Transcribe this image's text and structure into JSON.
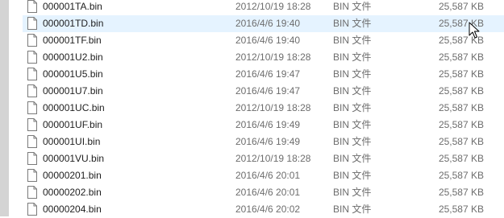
{
  "files": [
    {
      "name": "000001TA.bin",
      "date": "2012/10/19 18:28",
      "type": "BIN 文件",
      "size": "25,587 KB"
    },
    {
      "name": "000001TD.bin",
      "date": "2016/4/6 19:40",
      "type": "BIN 文件",
      "size": "25,587 KB"
    },
    {
      "name": "000001TF.bin",
      "date": "2016/4/6 19:40",
      "type": "BIN 文件",
      "size": "25,587 KB"
    },
    {
      "name": "000001U2.bin",
      "date": "2012/10/19 18:28",
      "type": "BIN 文件",
      "size": "25,587 KB"
    },
    {
      "name": "000001U5.bin",
      "date": "2016/4/6 19:47",
      "type": "BIN 文件",
      "size": "25,587 KB"
    },
    {
      "name": "000001U7.bin",
      "date": "2016/4/6 19:47",
      "type": "BIN 文件",
      "size": "25,587 KB"
    },
    {
      "name": "000001UC.bin",
      "date": "2012/10/19 18:28",
      "type": "BIN 文件",
      "size": "25,587 KB"
    },
    {
      "name": "000001UF.bin",
      "date": "2016/4/6 19:49",
      "type": "BIN 文件",
      "size": "25,587 KB"
    },
    {
      "name": "000001UI.bin",
      "date": "2016/4/6 19:49",
      "type": "BIN 文件",
      "size": "25,587 KB"
    },
    {
      "name": "000001VU.bin",
      "date": "2012/10/19 18:28",
      "type": "BIN 文件",
      "size": "25,587 KB"
    },
    {
      "name": "00000201.bin",
      "date": "2016/4/6 20:01",
      "type": "BIN 文件",
      "size": "25,587 KB"
    },
    {
      "name": "00000202.bin",
      "date": "2016/4/6 20:01",
      "type": "BIN 文件",
      "size": "25,587 KB"
    },
    {
      "name": "00000204.bin",
      "date": "2016/4/6 20:02",
      "type": "BIN 文件",
      "size": "25,587 KB"
    }
  ],
  "hover_index": 1,
  "icons": {
    "file": "file-icon",
    "cursor": "mouse-cursor-icon"
  },
  "colors": {
    "hover_background": "#e5f3ff",
    "secondary_text": "#6d6d6d",
    "primary_text": "#1e1e1e",
    "left_strip": "#d4d4d4"
  }
}
